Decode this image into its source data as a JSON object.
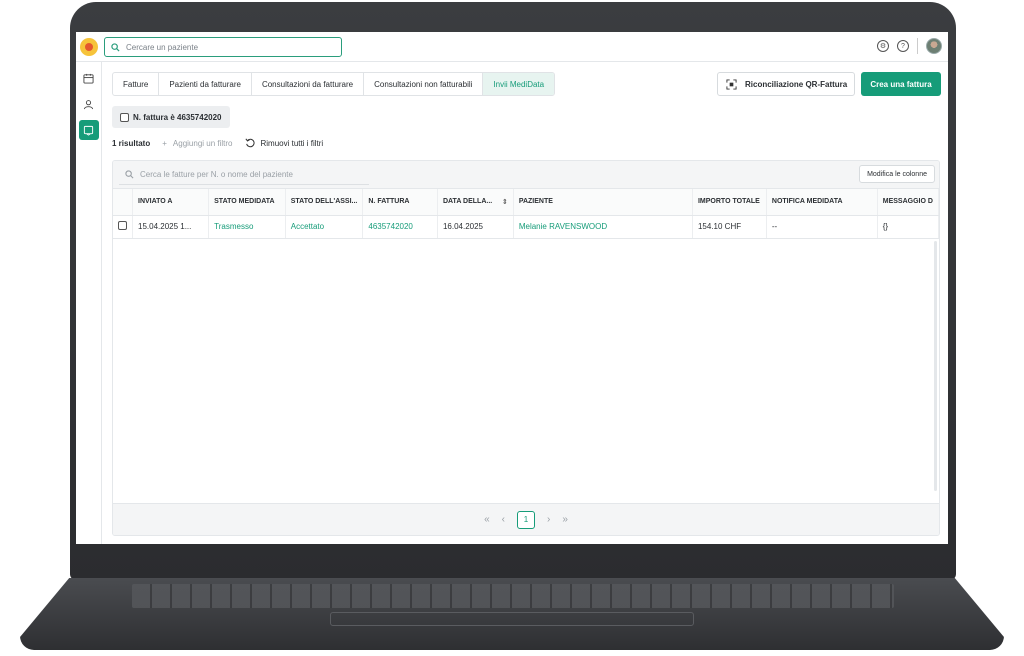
{
  "topbar": {
    "search_placeholder": "Cercare un paziente"
  },
  "tabs": [
    {
      "label": "Fatture"
    },
    {
      "label": "Pazienti da fatturare"
    },
    {
      "label": "Consultazioni da fatturare"
    },
    {
      "label": "Consultazioni non fatturabili"
    },
    {
      "label": "Invii MediData",
      "active": true
    }
  ],
  "actions": {
    "qr_label": "Riconciliazione QR-Fattura",
    "create_label": "Crea una fattura"
  },
  "filter": {
    "chip_label": "N. fattura è 4635742020",
    "result_count": "1 risultato",
    "add_filter": "Aggiungi un filtro",
    "remove_filters": "Rimuovi tutti i filtri"
  },
  "table": {
    "search_placeholder": "Cerca le fatture per N. o nome del paziente",
    "columns_button": "Modifica le colonne",
    "headers": [
      "INVIATO A",
      "STATO MEDIDATA",
      "STATO DELL'ASSI...",
      "N. FATTURA",
      "DATA DELLA...",
      "PAZIENTE",
      "IMPORTO TOTALE",
      "NOTIFICA MEDIDATA",
      "MESSAGGIO D"
    ],
    "rows": [
      {
        "sent_to": "15.04.2025 1...",
        "medidata_status": "Trasmesso",
        "insurer_status": "Accettato",
        "invoice_no": "4635742020",
        "date": "16.04.2025",
        "patient": "Melanie RAVENSWOOD",
        "total": "154.10 CHF",
        "notification": "--",
        "message": "{}"
      }
    ]
  },
  "pagination": {
    "current_page": "1",
    "first": "«",
    "prev": "‹",
    "next": "›",
    "last": "»"
  },
  "colors": {
    "accent": "#169c79",
    "active_tab_bg": "#e7f4f0"
  }
}
